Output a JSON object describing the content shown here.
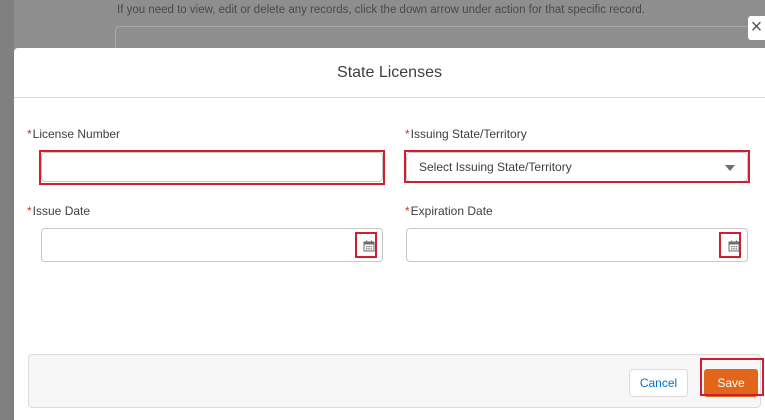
{
  "background": {
    "instruction_text": "If you need to view, edit or delete any records, click the down arrow under action for that specific record."
  },
  "modal": {
    "title": "State Licenses",
    "close_glyph": "×",
    "fields": {
      "license_number": {
        "required_mark": "*",
        "label": "License Number",
        "value": ""
      },
      "issuing_state": {
        "required_mark": "*",
        "label": "Issuing State/Territory",
        "selected": "Select Issuing State/Territory"
      },
      "issue_date": {
        "required_mark": "*",
        "label": "Issue Date",
        "value": ""
      },
      "expiration_date": {
        "required_mark": "*",
        "label": "Expiration Date",
        "value": ""
      }
    },
    "buttons": {
      "cancel_label": "Cancel",
      "save_label": "Save"
    }
  },
  "colors": {
    "highlight": "#cc1f2f",
    "save_button": "#e1661b",
    "required_asterisk": "#c23934",
    "link_blue": "#0070d2"
  },
  "icons": [
    "close-icon",
    "calendar-icon",
    "chevron-down-icon"
  ]
}
